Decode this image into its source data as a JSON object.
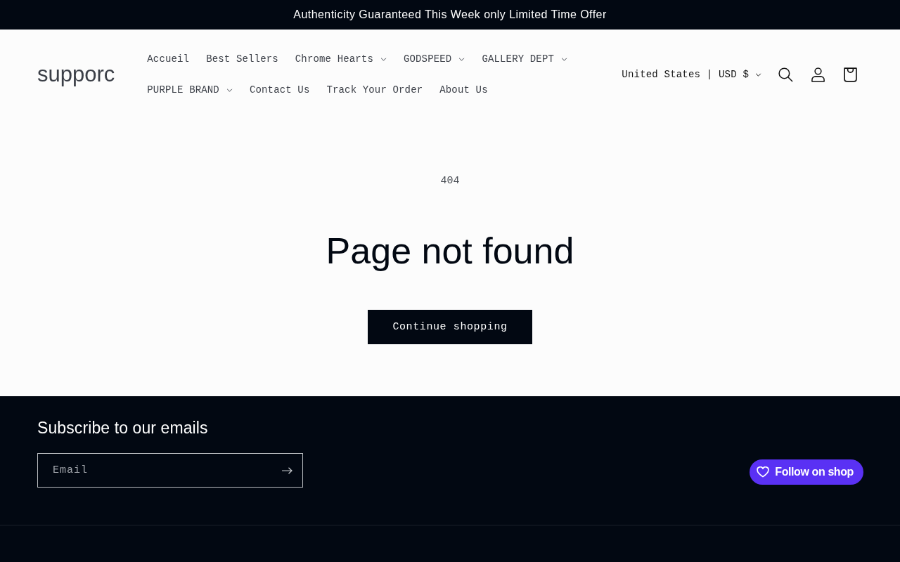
{
  "announcement": {
    "text": "Authenticity Guaranteed This Week only Limited Time Offer"
  },
  "header": {
    "logo": "supporc",
    "nav": [
      {
        "label": "Accueil",
        "dropdown": false
      },
      {
        "label": "Best Sellers",
        "dropdown": false
      },
      {
        "label": "Chrome Hearts",
        "dropdown": true
      },
      {
        "label": "GODSPEED",
        "dropdown": true
      },
      {
        "label": "GALLERY DEPT",
        "dropdown": true
      },
      {
        "label": "PURPLE BRAND",
        "dropdown": true
      },
      {
        "label": "Contact Us",
        "dropdown": false
      },
      {
        "label": "Track Your Order",
        "dropdown": false
      },
      {
        "label": "About Us",
        "dropdown": false
      }
    ],
    "country_selector": {
      "label": "United States | USD $"
    }
  },
  "main": {
    "code": "404",
    "title": "Page not found",
    "button": "Continue shopping"
  },
  "footer": {
    "newsletter": {
      "heading": "Subscribe to our emails",
      "email": {
        "placeholder": "Email"
      }
    },
    "follow_button": {
      "label": "Follow on shop"
    }
  }
}
